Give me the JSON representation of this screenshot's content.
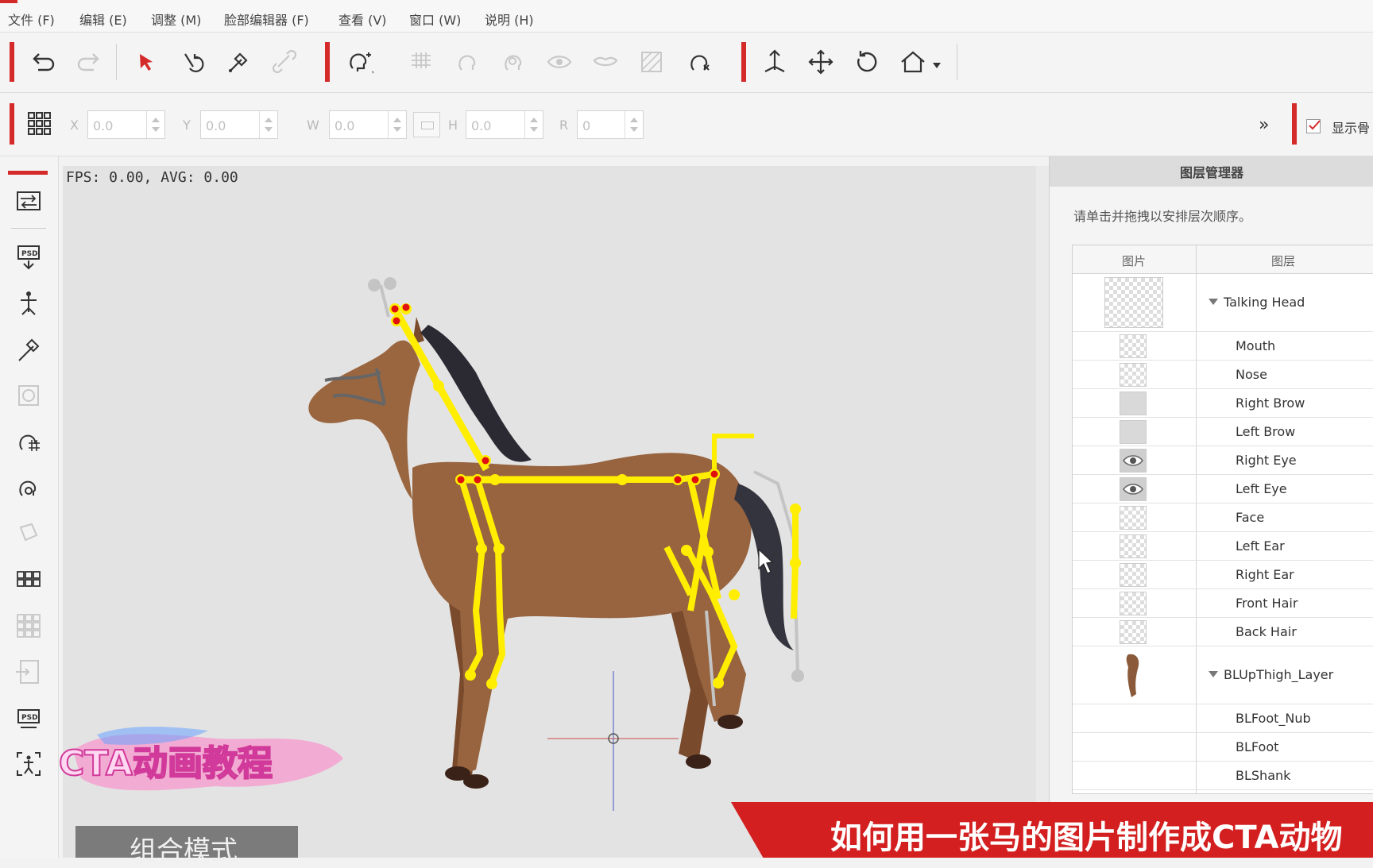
{
  "menu": [
    "文件 (F)",
    "编辑 (E)",
    "调整 (M)",
    "脸部编辑器 (F)",
    "查看 (V)",
    "窗口 (W)",
    "说明 (H)"
  ],
  "toolbar": {
    "icons": [
      "undo-icon",
      "redo-icon",
      "select-arrow-icon",
      "rotate-bone-icon",
      "bone-edit-icon",
      "link-icon",
      "head-add-icon",
      "mesh-grid-icon",
      "head-outline-icon",
      "head-locate-icon",
      "eye-icon",
      "mouth-icon",
      "texture-icon",
      "head-delete-icon",
      "bone-up-icon",
      "move-icon",
      "rotate-icon",
      "home-icon"
    ],
    "accent": "#d42a2a"
  },
  "transform": {
    "x_label": "X",
    "x_value": "0.0",
    "y_label": "Y",
    "y_value": "0.0",
    "w_label": "W",
    "w_value": "0.0",
    "h_label": "H",
    "h_value": "0.0",
    "r_label": "R",
    "r_value": "0",
    "more": "»",
    "show_bone_label": "显示骨",
    "show_bone_checked": true
  },
  "viewport": {
    "stats": "FPS: 0.00, AVG: 0.00",
    "mode_label": "组合模式",
    "background": "#e3e3e3"
  },
  "layer_manager": {
    "title": "图层管理器",
    "hint": "请单击并拖拽以安排层次顺序。",
    "col_image": "图片",
    "col_layer": "图层",
    "rows": [
      {
        "name": "Talking Head",
        "group": true
      },
      {
        "name": "Mouth"
      },
      {
        "name": "Nose"
      },
      {
        "name": "Right Brow"
      },
      {
        "name": "Left Brow"
      },
      {
        "name": "Right Eye"
      },
      {
        "name": "Left Eye"
      },
      {
        "name": "Face"
      },
      {
        "name": "Left Ear"
      },
      {
        "name": "Right Ear"
      },
      {
        "name": "Front Hair"
      },
      {
        "name": "Back Hair"
      },
      {
        "name": "BLUpThigh_Layer",
        "group": true
      },
      {
        "name": "BLFoot_Nub"
      },
      {
        "name": "BLFoot"
      },
      {
        "name": "BLShank"
      }
    ]
  },
  "overlay": {
    "watermark": "CTA动画教程",
    "banner": "如何用一张马的图片制作成CTA动物"
  }
}
